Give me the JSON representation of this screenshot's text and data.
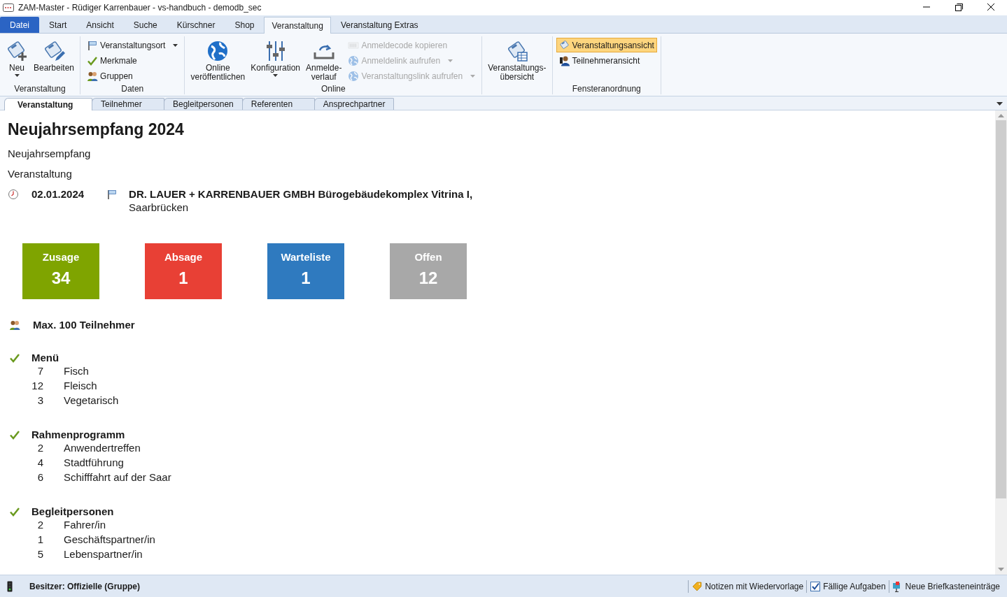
{
  "window": {
    "title": "ZAM-Master - Rüdiger Karrenbauer - vs-handbuch - demodb_sec"
  },
  "menu_tabs": [
    {
      "label": "Datei",
      "kind": "file",
      "selected": false
    },
    {
      "label": "Start",
      "kind": "tab",
      "selected": false
    },
    {
      "label": "Ansicht",
      "kind": "tab",
      "selected": false
    },
    {
      "label": "Suche",
      "kind": "tab",
      "selected": false
    },
    {
      "label": "Kürschner",
      "kind": "tab",
      "selected": false
    },
    {
      "label": "Shop",
      "kind": "tab",
      "selected": false
    },
    {
      "label": "Veranstaltung",
      "kind": "tab",
      "selected": true
    },
    {
      "label": "Veranstaltung Extras",
      "kind": "tab",
      "selected": false
    }
  ],
  "ribbon": {
    "groups": [
      {
        "label": "Veranstaltung",
        "items": [
          {
            "label": "Neu",
            "kind": "large",
            "dropdown": true,
            "disabled": false,
            "selected": false
          },
          {
            "label": "Bearbeiten",
            "kind": "large",
            "dropdown": false,
            "disabled": false,
            "selected": false
          }
        ]
      },
      {
        "label": "Daten",
        "items": [
          {
            "label": "Veranstaltungsort",
            "kind": "small",
            "dropdown": true,
            "disabled": false,
            "selected": false
          },
          {
            "label": "Merkmale",
            "kind": "small",
            "dropdown": false,
            "disabled": false,
            "selected": false
          },
          {
            "label": "Gruppen",
            "kind": "small",
            "dropdown": false,
            "disabled": false,
            "selected": false
          }
        ]
      },
      {
        "label": "Online",
        "items": [
          {
            "label": "Online\nveröffentlichen",
            "kind": "large",
            "dropdown": false,
            "disabled": false,
            "selected": false
          },
          {
            "label": "Konfiguration",
            "kind": "large",
            "dropdown": true,
            "disabled": false,
            "selected": false
          },
          {
            "label": "Anmelde-\nverlauf",
            "kind": "large",
            "dropdown": false,
            "disabled": false,
            "selected": false
          },
          {
            "label": "Anmeldecode kopieren",
            "kind": "small",
            "dropdown": false,
            "disabled": true,
            "selected": false
          },
          {
            "label": "Anmeldelink aufrufen",
            "kind": "small",
            "dropdown": true,
            "disabled": true,
            "selected": false
          },
          {
            "label": "Veranstaltungslink aufrufen",
            "kind": "small",
            "dropdown": true,
            "disabled": true,
            "selected": false
          }
        ]
      },
      {
        "items": [
          {
            "label": "Veranstaltungs-\nübersicht",
            "kind": "large",
            "dropdown": false,
            "disabled": false,
            "selected": false
          }
        ]
      },
      {
        "label": "Fensteranordnung",
        "items": [
          {
            "label": "Veranstaltungsansicht",
            "kind": "small",
            "dropdown": false,
            "disabled": false,
            "selected": true
          },
          {
            "label": "Teilnehmeransicht",
            "kind": "small",
            "dropdown": false,
            "disabled": false,
            "selected": false
          }
        ]
      }
    ]
  },
  "doc_tabs": [
    {
      "label": "Veranstaltung",
      "selected": true
    },
    {
      "label": "Teilnehmer",
      "selected": false
    },
    {
      "label": "Begleitpersonen",
      "selected": false
    },
    {
      "label": "Referenten",
      "selected": false
    },
    {
      "label": "Ansprechpartner",
      "selected": false
    }
  ],
  "event": {
    "title": "Neujahrsempfang 2024",
    "subtitle": "Neujahrsempfang",
    "type": "Veranstaltung",
    "date": "02.01.2024",
    "venue": "DR. LAUER + KARRENBAUER GMBH Bürogebäudekomplex Vitrina I,",
    "city": "Saarbrücken"
  },
  "tiles": [
    {
      "label": "Zusage",
      "count": "34",
      "color": "#7fa400"
    },
    {
      "label": "Absage",
      "count": "1",
      "color": "#e84035"
    },
    {
      "label": "Warteliste",
      "count": "1",
      "color": "#2f7abf"
    },
    {
      "label": "Offen",
      "count": "12",
      "color": "#a8a8a8"
    }
  ],
  "capacity": "Max. 100 Teilnehmer",
  "sections": [
    {
      "title": "Menü",
      "rows": [
        {
          "count": "7",
          "label": "Fisch"
        },
        {
          "count": "12",
          "label": "Fleisch"
        },
        {
          "count": "3",
          "label": "Vegetarisch"
        }
      ]
    },
    {
      "title": "Rahmenprogramm",
      "rows": [
        {
          "count": "2",
          "label": "Anwendertreffen"
        },
        {
          "count": "4",
          "label": "Stadtführung"
        },
        {
          "count": "6",
          "label": "Schifffahrt auf der Saar"
        }
      ]
    },
    {
      "title": "Begleitpersonen",
      "rows": [
        {
          "count": "2",
          "label": "Fahrer/in"
        },
        {
          "count": "1",
          "label": "Geschäftspartner/in"
        },
        {
          "count": "5",
          "label": "Lebenspartner/in"
        }
      ]
    }
  ],
  "status_bar": {
    "owner": "Besitzer: Offizielle (Gruppe)",
    "items": [
      {
        "label": "Notizen mit Wiedervorlage"
      },
      {
        "label": "Fällige Aufgaben"
      },
      {
        "label": "Neue Briefkasteneinträge"
      }
    ]
  }
}
